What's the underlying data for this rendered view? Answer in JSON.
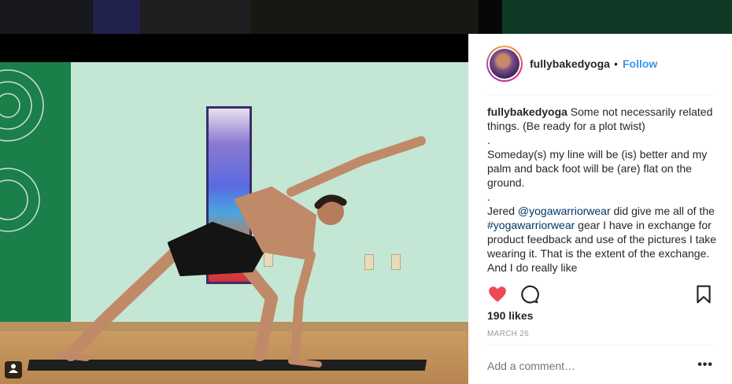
{
  "post": {
    "username": "fullybakedyoga",
    "separator": "•",
    "follow_label": "Follow",
    "caption": {
      "username": "fullybakedyoga",
      "line1": " Some not necessarily related things. (Be ready for a plot twist)",
      "dot1": ".",
      "line2": "Someday(s) my line will be (is) better and my palm and back foot will be (are) flat on the ground.",
      "dot2": ".",
      "line3_a": "Jered ",
      "mention": "@yogawarriorwear",
      "line3_b": " did give me all of the ",
      "hashtag": "#yogawarriorwear",
      "line3_c": " gear I have in exchange for product feedback and use of the pictures I take wearing it. That is the extent of the exchange. And I do really like"
    },
    "likes": "190 likes",
    "date": "MARCH 26",
    "comment_placeholder": "Add a comment…",
    "more_label": "•••"
  },
  "icons": {
    "like": "heart-icon",
    "comment": "comment-icon",
    "save": "bookmark-icon",
    "tag": "user-tag-icon"
  },
  "colors": {
    "like_red": "#ed4956",
    "follow_blue": "#3897f0",
    "link_blue": "#003569"
  }
}
